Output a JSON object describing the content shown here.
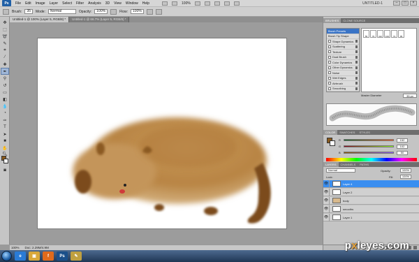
{
  "menubar": {
    "logo": "Ps",
    "items": [
      "File",
      "Edit",
      "Image",
      "Layer",
      "Select",
      "Filter",
      "Analysis",
      "3D",
      "View",
      "Window",
      "Help"
    ],
    "zoom": "100%",
    "workspace": "UNTITLED-1"
  },
  "options": {
    "brush_label": "Brush:",
    "brush_size": "35",
    "mode_label": "Mode:",
    "mode_value": "Normal",
    "opacity_label": "Opacity:",
    "opacity_value": "100%",
    "flow_label": "Flow:",
    "flow_value": "100%"
  },
  "tabs": [
    {
      "label": "Untitled-1 @ 100% (Layer 5, RGB/8) *",
      "active": true
    },
    {
      "label": "Untitled-1 @ 66.7% (Layer 5, RGB/8) *",
      "active": false
    }
  ],
  "status": {
    "zoom": "100%",
    "doc": "Doc: 2.29M/4.9M"
  },
  "brushes": {
    "tabs": [
      "BRUSHES",
      "CLONE SOURCE"
    ],
    "items": [
      "Brush Presets",
      "Brush Tip Shape",
      "Shape Dynamics",
      "Scattering",
      "Texture",
      "Dual Brush",
      "Color Dynamics",
      "Other Dynamics",
      "Noise",
      "Wet Edges",
      "Airbrush",
      "Smoothing",
      "Protect Texture"
    ],
    "grid": [
      "55",
      "70",
      "112",
      "134",
      "74",
      "95"
    ],
    "master_diameter_label": "Master Diameter",
    "master_diameter_value": "35 px"
  },
  "color": {
    "tabs": [
      "COLOR",
      "SWATCHES",
      "STYLES"
    ],
    "sliders": [
      {
        "label": "R",
        "value": "152",
        "track": "linear-gradient(90deg,#005a1c,#ff5a1c)"
      },
      {
        "label": "G",
        "value": "102",
        "track": "linear-gradient(90deg,#8a001c,#8aff1c)"
      },
      {
        "label": "B",
        "value": "50",
        "track": "linear-gradient(90deg,#8a5a00,#8a5aff)"
      }
    ]
  },
  "layers": {
    "tabs": [
      "LAYERS",
      "CHANNELS",
      "PATHS"
    ],
    "blend_mode": "Normal",
    "opacity_label": "Opacity:",
    "opacity_value": "100%",
    "lock_label": "Lock:",
    "fill_label": "Fill:",
    "fill_value": "100%",
    "items": [
      {
        "name": "Layer 4",
        "active": true
      },
      {
        "name": "Layer 2",
        "active": false
      },
      {
        "name": "body",
        "active": false
      },
      {
        "name": "smooths",
        "active": false
      },
      {
        "name": "Layer 1",
        "active": false
      }
    ]
  },
  "taskbar": {
    "icons": [
      {
        "name": "ie",
        "text": "e",
        "color": "#2a7bd6"
      },
      {
        "name": "folder",
        "text": "▣",
        "color": "#d8a83a"
      },
      {
        "name": "firefox",
        "text": "f",
        "color": "#e06a1c"
      },
      {
        "name": "photoshop",
        "text": "Ps",
        "color": "#1b4f8a"
      },
      {
        "name": "paint",
        "text": "✎",
        "color": "#c0a040"
      }
    ]
  },
  "watermark": {
    "prefix": "p",
    "x": "x",
    "suffix": "leyes.com"
  },
  "accent_color": "#3a8ef0"
}
